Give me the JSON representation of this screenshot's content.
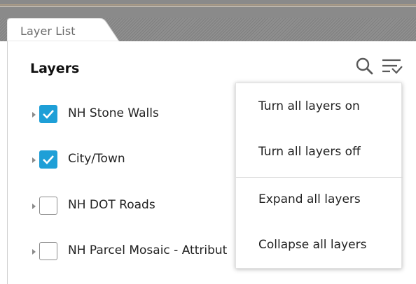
{
  "tab": {
    "label": "Layer List"
  },
  "panel": {
    "title": "Layers"
  },
  "tools": {
    "search_icon": "search-icon",
    "menu_icon": "filter-menu-icon"
  },
  "layers": [
    {
      "label": "NH Stone Walls",
      "checked": true
    },
    {
      "label": "City/Town",
      "checked": true
    },
    {
      "label": "NH DOT Roads",
      "checked": false
    },
    {
      "label": "NH Parcel Mosaic - Attribut",
      "checked": false
    }
  ],
  "menu": {
    "items": [
      {
        "label": "Turn all layers on"
      },
      {
        "label": "Turn all layers off"
      },
      {
        "label": "Expand all layers"
      },
      {
        "label": "Collapse all layers"
      }
    ]
  },
  "colors": {
    "checkbox_checked": "#1e9fd7",
    "tab_strip": "#8a8a8a"
  }
}
